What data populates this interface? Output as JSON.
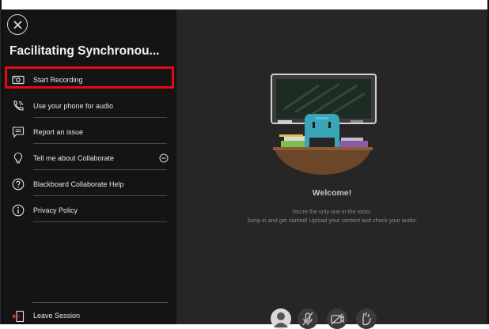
{
  "sidebar": {
    "title": "Facilitating Synchronou...",
    "items": [
      {
        "label": "Start Recording",
        "icon": "record-icon"
      },
      {
        "label": "Use your phone for audio",
        "icon": "phone-icon"
      },
      {
        "label": "Report an issue",
        "icon": "report-icon"
      },
      {
        "label": "Tell me about Collaborate",
        "icon": "lightbulb-icon"
      },
      {
        "label": "Blackboard Collaborate Help",
        "icon": "help-icon"
      },
      {
        "label": "Privacy Policy",
        "icon": "info-icon"
      }
    ],
    "leave_label": "Leave Session"
  },
  "main": {
    "welcome_title": "Welcome!",
    "welcome_line1": "You're the only one in the room.",
    "welcome_line2": "Jump in and get started! Upload your content and check your audio."
  },
  "colors": {
    "highlight": "#e50914",
    "accent_leave": "#e0312a",
    "sidebar_bg": "#141414",
    "main_bg": "#262626"
  }
}
